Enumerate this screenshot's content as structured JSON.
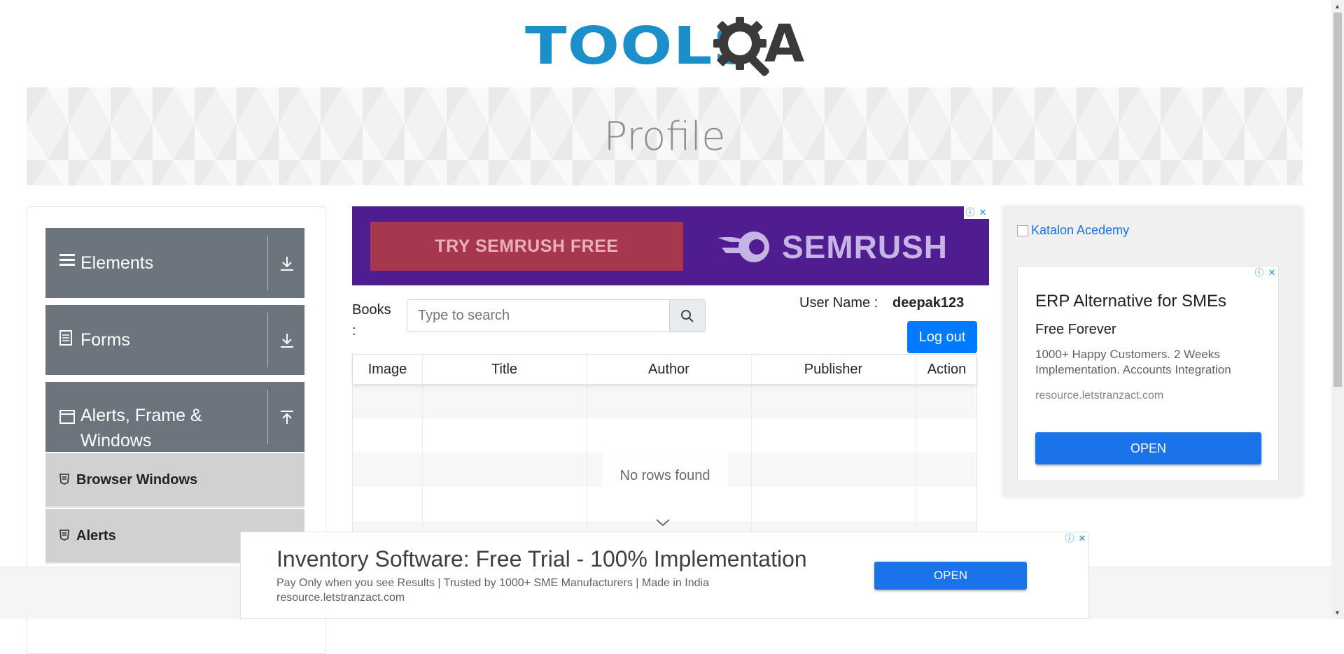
{
  "header": {
    "logo_text_primary": "TOOLS",
    "logo_text_secondary": "A",
    "logo_icon": "gear-magnifier-icon"
  },
  "banner": {
    "title": "Profile"
  },
  "sidebar": {
    "groups": [
      {
        "label": "Elements",
        "icon": "hamburger-icon",
        "toggle_icon": "download-arrow-icon"
      },
      {
        "label": "Forms",
        "icon": "document-icon",
        "toggle_icon": "download-arrow-icon"
      },
      {
        "label": "Alerts, Frame &",
        "label_line2": "Windows",
        "icon": "window-icon",
        "toggle_icon": "upload-arrow-icon"
      }
    ],
    "items": [
      {
        "label": "Browser Windows",
        "icon": "html5-shield-icon"
      },
      {
        "label": "Alerts",
        "icon": "html5-shield-icon"
      }
    ]
  },
  "top_ad": {
    "cta": "TRY SEMRUSH FREE",
    "brand": "SEMRUSH",
    "colors": {
      "background": "#4f1d8f",
      "cta_bg": "#a6374f"
    }
  },
  "books": {
    "label_line1": "Books",
    "label_line2": ":",
    "search_placeholder": "Type to search",
    "search_icon": "magnifier-icon"
  },
  "user": {
    "label": "User Name :",
    "value": "deepak123",
    "logout_label": "Log out"
  },
  "table": {
    "headers": [
      "Image",
      "Title",
      "Author",
      "Publisher",
      "Action"
    ],
    "rows": [],
    "empty_message": "No rows found"
  },
  "right_ad": {
    "broken_image_alt": "Katalon Acedemy",
    "title": "ERP Alternative for SMEs",
    "subtitle": "Free Forever",
    "description": "1000+ Happy Customers. 2 Weeks Implementation. Accounts Integration",
    "url": "resource.letstranzact.com",
    "button": "OPEN"
  },
  "bottom_ad": {
    "title": "Inventory Software: Free Trial - 100% Implementation",
    "description": "Pay Only when you see Results | Trusted by 1000+ SME Manufacturers | Made in India",
    "url": "resource.letstranzact.com",
    "button": "OPEN"
  },
  "colors": {
    "sidebar_group": "#6c757d",
    "sidebar_item": "#d1d1d1",
    "primary_button": "#007bff",
    "ad_button": "#1a73e8",
    "logo_blue": "#1a8fc9"
  }
}
